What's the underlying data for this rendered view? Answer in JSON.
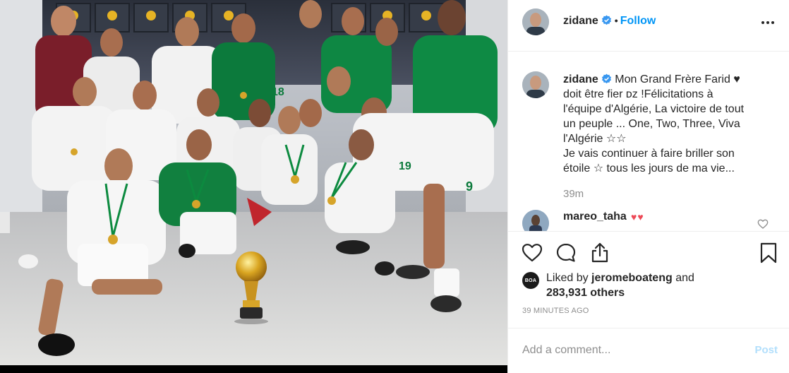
{
  "post": {
    "author": "zidane",
    "follow_label": "Follow",
    "dot": "•"
  },
  "caption": {
    "username": "zidane",
    "lines": [
      "Mon Grand Frère Farid ♥",
      "doit être fier ᴅᴢ !Félicitations à",
      "l'équipe d'Algérie, La victoire de tout",
      "un peuple ... One, Two, Three, Viva",
      "l'Algérie ☆☆",
      "Je vais continuer à faire briller son",
      "étoile ☆ tous les jours de ma vie..."
    ],
    "time_ago": "39m"
  },
  "comments": [
    {
      "username": "mareo_taha",
      "text": "♥♥"
    }
  ],
  "likes": {
    "badge": "BOA",
    "prefix": "Liked by",
    "user": "jeromeboateng",
    "conj": "and",
    "others": "283,931 others"
  },
  "timestamp": "39 minutes ago",
  "comment_box": {
    "placeholder": "Add a comment...",
    "post_label": "Post"
  },
  "icons": {
    "more": "more-options-icon",
    "like": "heart-icon",
    "comment": "comment-bubble-icon",
    "share": "share-icon",
    "save": "bookmark-icon",
    "verified": "verified-badge-icon"
  },
  "colors": {
    "link_blue": "#0095f6",
    "post_disabled": "#b2dffc",
    "heart_red": "#ed4956",
    "muted": "#8e8e8e",
    "text": "#262626",
    "team_green": "#0c7a3c"
  }
}
